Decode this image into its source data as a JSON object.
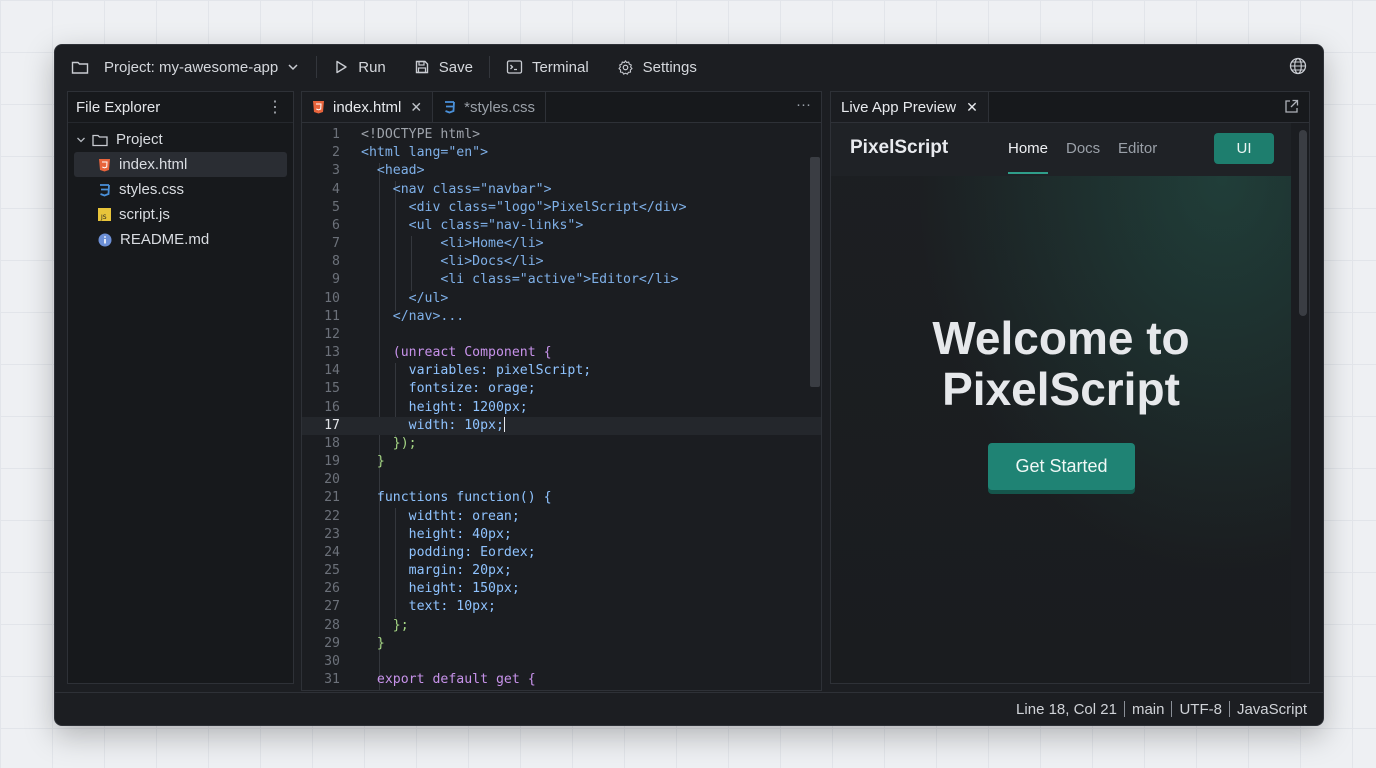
{
  "toolbar": {
    "project_label": "Project: my-awesome-app",
    "run_label": "Run",
    "save_label": "Save",
    "terminal_label": "Terminal",
    "settings_label": "Settings"
  },
  "explorer": {
    "title": "File Explorer",
    "root": "Project",
    "files": [
      {
        "name": "index.html",
        "icon": "html-file-icon",
        "selected": true
      },
      {
        "name": "styles.css",
        "icon": "css-file-icon"
      },
      {
        "name": "script.js",
        "icon": "js-file-icon"
      },
      {
        "name": "README.md",
        "icon": "info-file-icon"
      }
    ]
  },
  "editor": {
    "tabs": [
      {
        "label": "index.html",
        "active": true
      },
      {
        "label": "*styles.css",
        "active": false
      }
    ],
    "current_line": 18,
    "lines": [
      "<!DOCTYPE html>",
      "<html lang=\"en\">",
      "  <head>",
      "    <nav class=\"navbar\">",
      "      <div class=\"logo\">PixelScript</div>",
      "      <ul class=\"nav-links\">",
      "          <li>Home</li>",
      "          <li>Docs</li>",
      "          <li class=\"active\">Editor</li>",
      "      </ul>",
      "    </nav>...",
      "",
      "    (unreact Component {",
      "      variables: pixelScript;",
      "      fontsize: orage;",
      "      height: 1200px;",
      "      width: 10px;",
      "    });",
      "  }",
      "",
      "  functions function() {",
      "      widtht: orean;",
      "      height: 40px;",
      "      podding: Eordex;",
      "      margin: 20px;",
      "      height: 150px;",
      "      text: 10px;",
      "    };",
      "  }",
      "",
      "  export default get {"
    ]
  },
  "preview": {
    "tab_label": "Live App Preview",
    "logo": "PixelScript",
    "nav_links": [
      "Home",
      "Docs",
      "Editor"
    ],
    "ui_button": "UI",
    "hero_line1": "Welcome to",
    "hero_line2": "PixelScript",
    "cta": "Get Started"
  },
  "status": {
    "position": "Line 18, Col 21",
    "branch": "main",
    "encoding": "UTF-8",
    "language": "JavaScript"
  },
  "colors": {
    "accent": "#1f8374",
    "html_icon": "#e8643c",
    "css_icon": "#4a90d9",
    "js_icon": "#e8c43a"
  }
}
